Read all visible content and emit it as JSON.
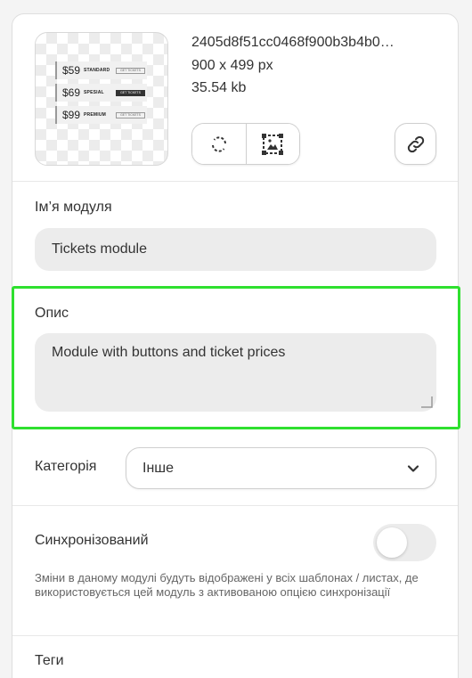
{
  "image": {
    "filename": "2405d8f51cc0468f900b3b4b0…",
    "dimensions": "900 x 499 px",
    "size": "35.54 kb",
    "preview_tickets": [
      {
        "price": "$59",
        "name": "STANDARD",
        "button": "GET TICKETS"
      },
      {
        "price": "$69",
        "name": "SPESIAL",
        "button": "GET TICKETS"
      },
      {
        "price": "$99",
        "name": "PREMIUM",
        "button": "GET TICKETS"
      }
    ],
    "actions": {
      "replace_icon": "refresh-icon",
      "crop_icon": "crop-image-icon",
      "link_icon": "link-icon"
    }
  },
  "fields": {
    "name": {
      "label": "Ім’я модуля",
      "value": "Tickets module"
    },
    "description": {
      "label": "Опис",
      "value": "Module with buttons and ticket prices"
    },
    "category": {
      "label": "Категорія",
      "value": "Інше"
    },
    "synced": {
      "label": "Синхронізований",
      "enabled": false,
      "hint": "Зміни в даному модулі будуть відображені у всіх шаблонах / листах, де використовується цей модуль з активованою опцією синхронізації"
    },
    "tags": {
      "label": "Теги"
    }
  },
  "colors": {
    "highlight": "#2fe02f",
    "input_bg": "#ececec"
  }
}
